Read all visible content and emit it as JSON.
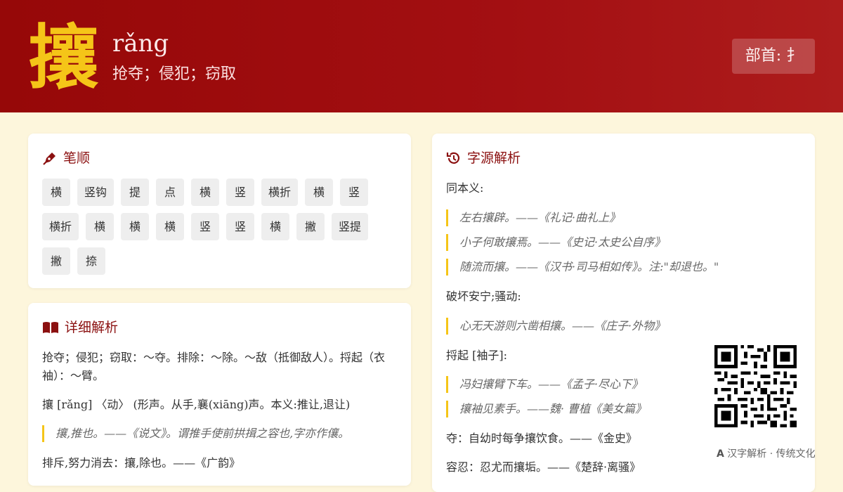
{
  "header": {
    "character": "攘",
    "pinyin": "rǎng",
    "meaning": "抢夺；侵犯；窃取",
    "radical": "部首: 扌"
  },
  "stroke_card": {
    "title": "笔顺",
    "icon": "pen-icon",
    "strokes": [
      "横",
      "竖钩",
      "提",
      "点",
      "横",
      "竖",
      "横折",
      "横",
      "竖",
      "横折",
      "横",
      "横",
      "横",
      "竖",
      "竖",
      "横",
      "撇",
      "竖提",
      "撇",
      "捺"
    ]
  },
  "detail_card": {
    "title": "详细解析",
    "icon": "book-icon",
    "para1": "抢夺；侵犯；窃取：～夺。排除：～除。～敌（抵御敌人）。捋起（衣袖）：～臂。",
    "para2": "攘 [rǎng] 〈动〉 (形声。从手,襄(xiāng)声。本义:推让,退让)",
    "quote1": "攘,推也。——《说文》。谓推手使前拱揖之容也,字亦作儴。",
    "para3": "排斥,努力消去：攘,除也。——《广韵》"
  },
  "origin_card": {
    "title": "字源解析",
    "icon": "history-icon",
    "sections": [
      {
        "label": "同本义:",
        "quotes": [
          "左右攘辟。——《礼记·曲礼上》",
          "小子何敢攘焉。——《史记·太史公自序》",
          "随流而攘。——《汉书·司马相如传》。注:\"却退也。\""
        ]
      },
      {
        "label": "破坏安宁;骚动:",
        "quotes": [
          "心无天游则六凿相攘。——《庄子·外物》"
        ]
      },
      {
        "label": "捋起 [袖子]:",
        "quotes": [
          "冯妇攘臂下车。——《孟子·尽心下》",
          "攘袖见素手。——魏· 曹植《美女篇》"
        ]
      }
    ],
    "line_duo": "夺：自幼时每争攘饮食。——《金史》",
    "line_rongren": "容忍：忍尤而攘垢。——《楚辞·离骚》"
  },
  "footer": {
    "brand": "汉字解析 · 传统文化",
    "qr_icon": "qr-code-icon"
  },
  "colors": {
    "header_red": "#9a0b0b",
    "gold": "#f5c518",
    "title_red": "#8b1010",
    "background": "#fdf6dc"
  }
}
